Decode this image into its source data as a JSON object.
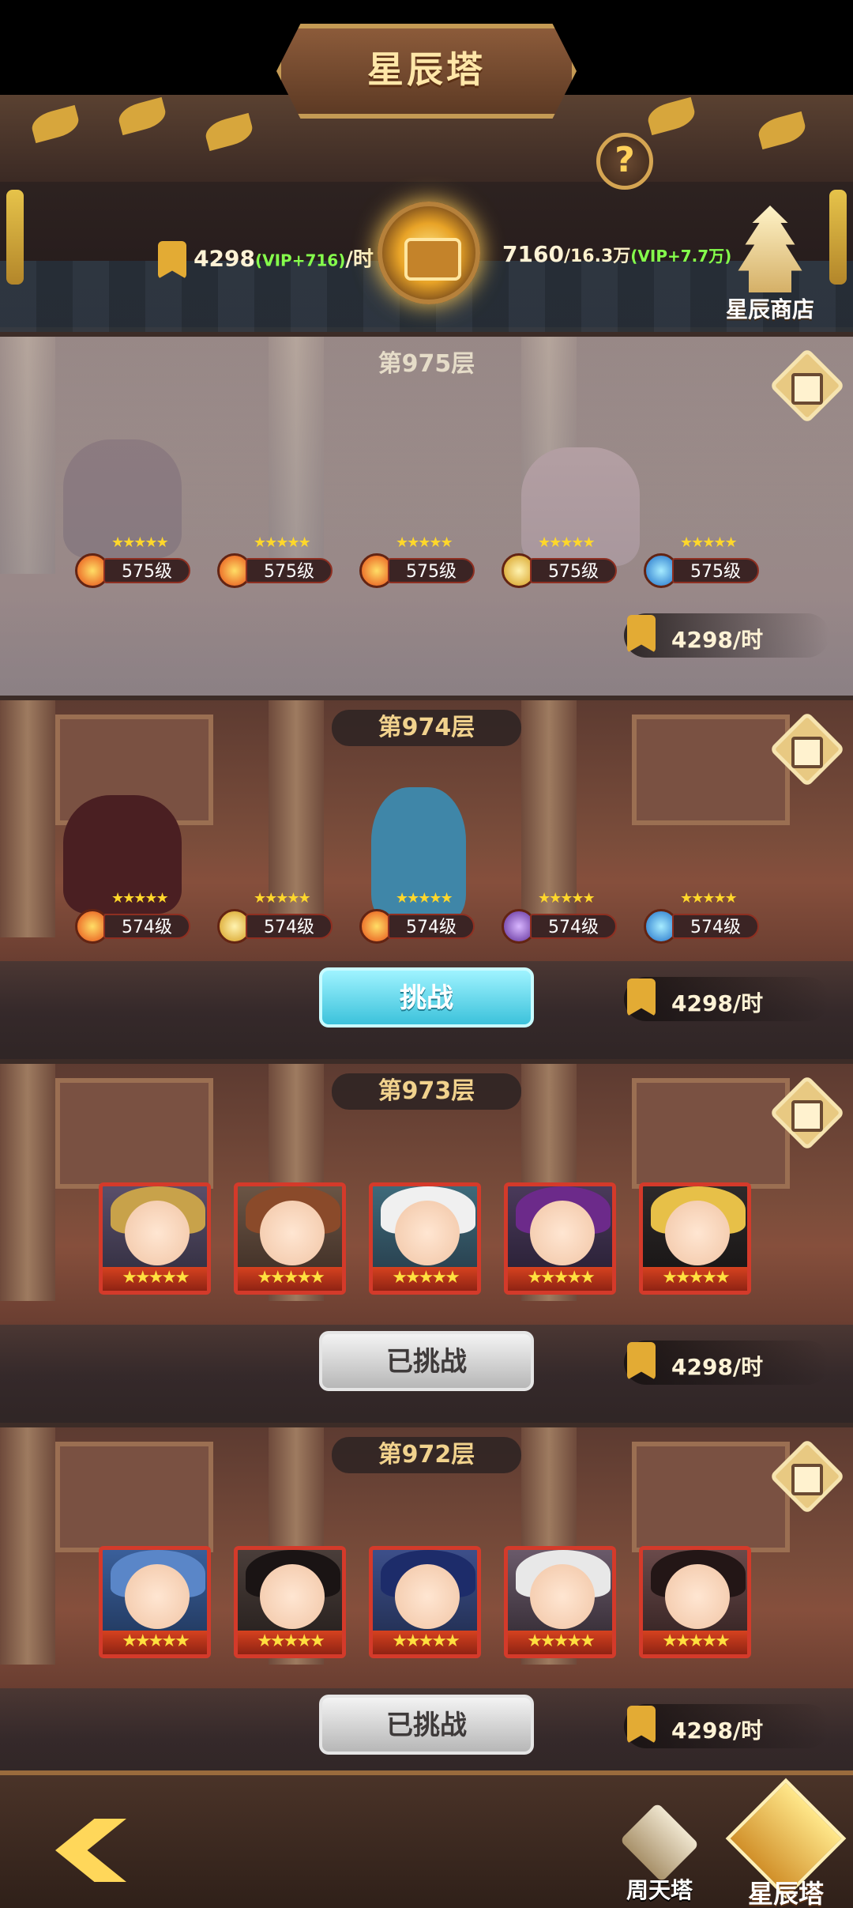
{
  "header": {
    "title": "星辰塔",
    "help_label": "?",
    "income_left": {
      "amount": "4298",
      "vip": "(VIP+716)",
      "unit": "/时"
    },
    "income_right": {
      "amount": "7160",
      "cap": "/16.3万",
      "vip": "(VIP+7.7万)"
    },
    "shop_label": "星辰商店"
  },
  "floors": [
    {
      "label": "第975层",
      "state": "locked",
      "heroes": [
        {
          "level": "575级",
          "element": "fire",
          "stars": "★★★★★"
        },
        {
          "level": "575级",
          "element": "fire",
          "stars": "★★★★★"
        },
        {
          "level": "575级",
          "element": "fire",
          "stars": "★★★★★"
        },
        {
          "level": "575级",
          "element": "light",
          "stars": "★★★★★"
        },
        {
          "level": "575级",
          "element": "water",
          "stars": "★★★★★"
        }
      ],
      "reward": "4298/时"
    },
    {
      "label": "第974层",
      "state": "available",
      "button_label": "挑战",
      "heroes": [
        {
          "level": "574级",
          "element": "fire",
          "stars": "★★★★★"
        },
        {
          "level": "574级",
          "element": "light",
          "stars": "★★★★★"
        },
        {
          "level": "574级",
          "element": "fire",
          "stars": "★★★★★"
        },
        {
          "level": "574级",
          "element": "moon",
          "stars": "★★★★★"
        },
        {
          "level": "574级",
          "element": "water",
          "stars": "★★★★★"
        }
      ],
      "reward": "4298/时"
    },
    {
      "label": "第973层",
      "state": "completed",
      "button_label": "已挑战",
      "portrait_stars": "★★★★★",
      "reward": "4298/时"
    },
    {
      "label": "第972层",
      "state": "completed",
      "button_label": "已挑战",
      "portrait_stars": "★★★★★",
      "reward": "4298/时"
    }
  ],
  "bottom_nav": {
    "weekly_tower": "周天塔",
    "star_tower": "星辰塔"
  },
  "colors": {
    "accent_gold": "#ffd15a",
    "challenge_cyan": "#3cc2db",
    "vip_green": "#85ff4c",
    "frame_red": "#d43a2a"
  }
}
